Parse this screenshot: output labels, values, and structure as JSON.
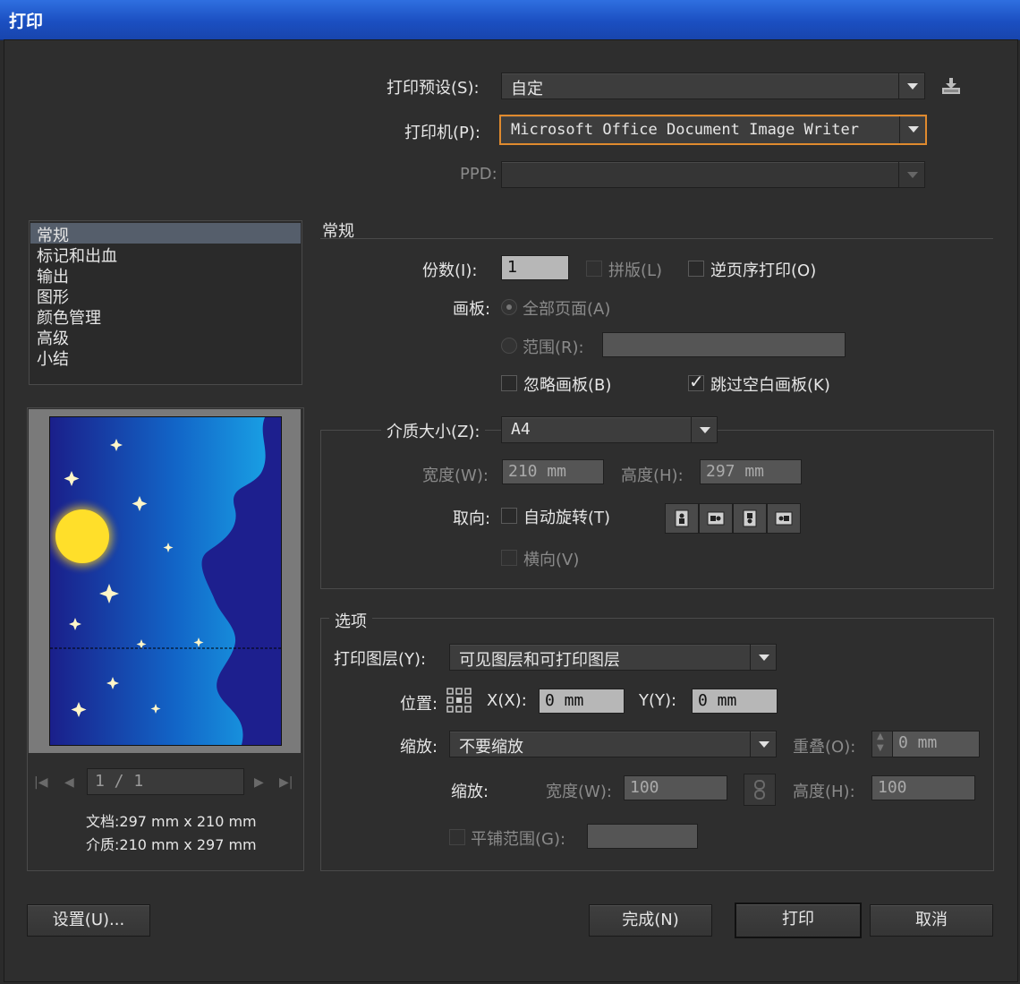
{
  "window": {
    "title": "打印"
  },
  "top": {
    "preset_label": "打印预设(S):",
    "preset_value": "自定",
    "printer_label": "打印机(P):",
    "printer_value": "Microsoft Office Document Image Writer",
    "ppd_label": "PPD:",
    "ppd_value": ""
  },
  "sidebar": {
    "items": [
      {
        "label": "常规",
        "selected": true
      },
      {
        "label": "标记和出血"
      },
      {
        "label": "输出"
      },
      {
        "label": "图形"
      },
      {
        "label": "颜色管理"
      },
      {
        "label": "高级"
      },
      {
        "label": "小结"
      }
    ]
  },
  "preview": {
    "page_indicator": "1 / 1",
    "document_size": "文档:297 mm x 210 mm",
    "media_size": "介质:210 mm x 297 mm"
  },
  "general": {
    "section_title": "常规",
    "copies_label": "份数(I):",
    "copies_value": "1",
    "collate_label": "拼版(L)",
    "reverse_label": "逆页序打印(O)",
    "artboard_label": "画板:",
    "all_pages_label": "全部页面(A)",
    "range_label": "范围(R):",
    "range_value": "",
    "ignore_artboard_label": "忽略画板(B)",
    "skip_blank_label": "跳过空白画板(K)",
    "skip_blank_checked": true
  },
  "media": {
    "size_label": "介质大小(Z):",
    "size_value": "A4",
    "width_label": "宽度(W):",
    "width_value": "210 mm",
    "height_label": "高度(H):",
    "height_value": "297 mm",
    "orientation_label": "取向:",
    "auto_rotate_label": "自动旋转(T)",
    "landscape_label": "横向(V)",
    "orientation_icons": [
      "portrait-icon",
      "landscape-icon",
      "portrait-flipped-icon",
      "landscape-flipped-icon"
    ]
  },
  "options": {
    "section_title": "选项",
    "layers_label": "打印图层(Y):",
    "layers_value": "可见图层和可打印图层",
    "position_label": "位置:",
    "x_label": "X(X):",
    "x_value": "0 mm",
    "y_label": "Y(Y):",
    "y_value": "0 mm",
    "scale_label": "缩放:",
    "scale_value": "不要缩放",
    "overlap_label": "重叠(O):",
    "overlap_value": "0 mm",
    "scale2_label": "缩放:",
    "scale_width_label": "宽度(W):",
    "scale_width_value": "100",
    "scale_height_label": "高度(H):",
    "scale_height_value": "100",
    "tile_label": "平铺范围(G):",
    "tile_value": ""
  },
  "buttons": {
    "setup": "设置(U)...",
    "done": "完成(N)",
    "print": "打印",
    "cancel": "取消"
  },
  "colors": {
    "title_bar": "#1f55c9",
    "dialog_bg": "#2e2e2e",
    "focus_ring": "#e08a2e",
    "sky_dark": "#1a1f8a",
    "sky_light": "#1aa8e8",
    "moon": "#ffdd2a"
  }
}
